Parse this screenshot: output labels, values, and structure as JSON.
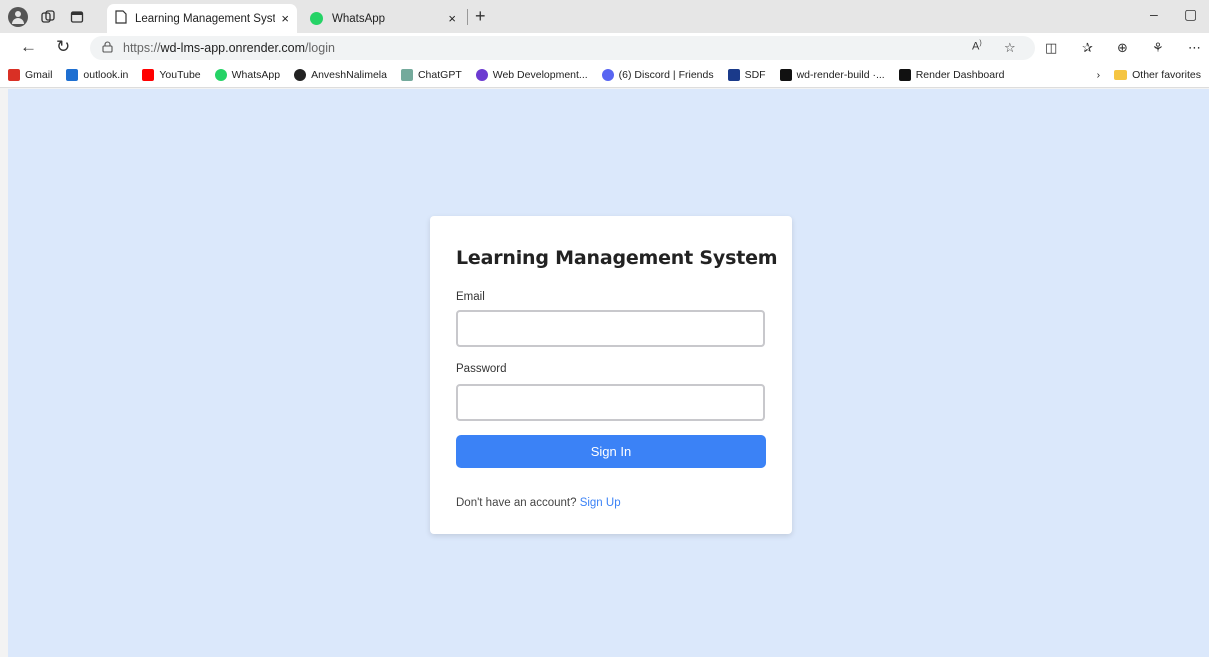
{
  "browser": {
    "tabs": [
      {
        "title": "Learning Management System--",
        "active": true,
        "close": "×"
      },
      {
        "title": "WhatsApp",
        "active": false,
        "close": "×"
      }
    ],
    "new_tab": "+",
    "minimize": "–",
    "restore": "▢",
    "url": {
      "scheme": "https://",
      "host": "wd-lms-app.onrender.com",
      "path": "/login"
    },
    "bookmarks": [
      {
        "label": "Gmail",
        "icon": "gmail-icon",
        "color": "#d93025"
      },
      {
        "label": "outlook.in",
        "icon": "outlook-icon",
        "color": "#1e6fd1"
      },
      {
        "label": "YouTube",
        "icon": "youtube-icon",
        "color": "#ff0000"
      },
      {
        "label": "WhatsApp",
        "icon": "whatsapp-icon",
        "color": "#25d366"
      },
      {
        "label": "AnveshNalimela",
        "icon": "github-icon",
        "color": "#222222"
      },
      {
        "label": "ChatGPT",
        "icon": "chatgpt-icon",
        "color": "#74aa9c"
      },
      {
        "label": "Web Development...",
        "icon": "web-dev-icon",
        "color": "#6c3bd1"
      },
      {
        "label": "(6) Discord | Friends",
        "icon": "discord-icon",
        "color": "#5865f2"
      },
      {
        "label": "SDF",
        "icon": "sdf-icon",
        "color": "#1a3a8a"
      },
      {
        "label": "wd-render-build ·...",
        "icon": "render-icon",
        "color": "#111111"
      },
      {
        "label": "Render Dashboard",
        "icon": "render-icon",
        "color": "#111111"
      }
    ],
    "other_favorites": "Other favorites"
  },
  "login": {
    "title": "Learning Management System",
    "email_label": "Email",
    "email_value": "",
    "password_label": "Password",
    "password_value": "",
    "submit_label": "Sign In",
    "signup_prompt": "Don't have an account?",
    "signup_link": "Sign Up"
  },
  "colors": {
    "page_bg": "#dbe8fb",
    "primary": "#3b82f6"
  }
}
